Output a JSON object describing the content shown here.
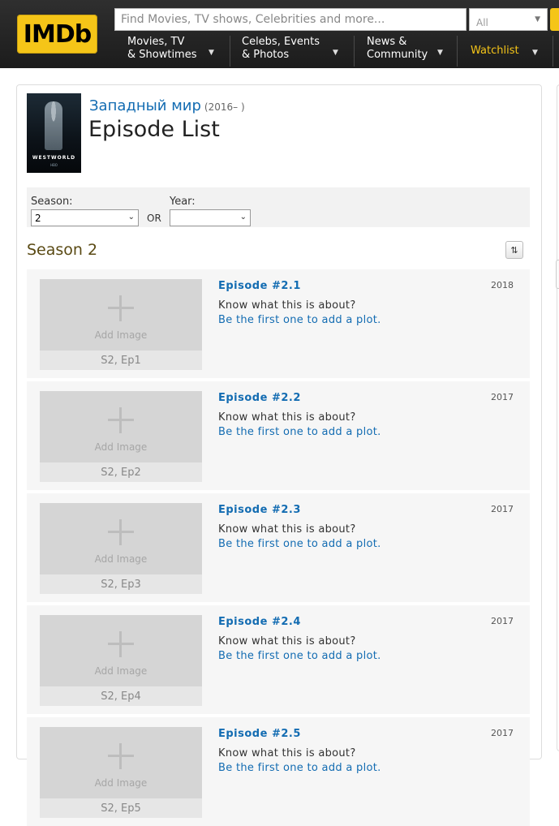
{
  "header": {
    "logo": "IMDb",
    "search_placeholder": "Find Movies, TV shows, Celebrities and more...",
    "search_category": "All",
    "nav": [
      {
        "line1": "Movies, TV",
        "line2": "& Showtimes"
      },
      {
        "line1": "Celebs, Events",
        "line2": "& Photos"
      },
      {
        "line1": "News &",
        "line2": "Community"
      },
      {
        "line1": "Watchlist",
        "line2": ""
      }
    ]
  },
  "show": {
    "poster_title": "WESTWORLD",
    "poster_sub": "HBO",
    "title": "Западный мир",
    "years": "(2016– )",
    "page_title": "Episode List"
  },
  "filters": {
    "season_label": "Season:",
    "season_value": "2",
    "or_label": "OR",
    "year_label": "Year:",
    "year_value": ""
  },
  "season_heading": "Season 2",
  "episodes": [
    {
      "title": "Episode #2.1",
      "date": "2018",
      "image_label": "Add Image",
      "number": "S2, Ep1",
      "question": "Know what this is about?",
      "plot_link": "Be the first one to add a plot."
    },
    {
      "title": "Episode #2.2",
      "date": "2017",
      "image_label": "Add Image",
      "number": "S2, Ep2",
      "question": "Know what this is about?",
      "plot_link": "Be the first one to add a plot."
    },
    {
      "title": "Episode #2.3",
      "date": "2017",
      "image_label": "Add Image",
      "number": "S2, Ep3",
      "question": "Know what this is about?",
      "plot_link": "Be the first one to add a plot."
    },
    {
      "title": "Episode #2.4",
      "date": "2017",
      "image_label": "Add Image",
      "number": "S2, Ep4",
      "question": "Know what this is about?",
      "plot_link": "Be the first one to add a plot."
    },
    {
      "title": "Episode #2.5",
      "date": "2017",
      "image_label": "Add Image",
      "number": "S2, Ep5",
      "question": "Know what this is about?",
      "plot_link": "Be the first one to add a plot."
    }
  ],
  "colors": {
    "brand_yellow": "#f5c518",
    "link_blue": "#136cb2",
    "header_bg": "#262626",
    "season_heading": "#5a4a14"
  }
}
